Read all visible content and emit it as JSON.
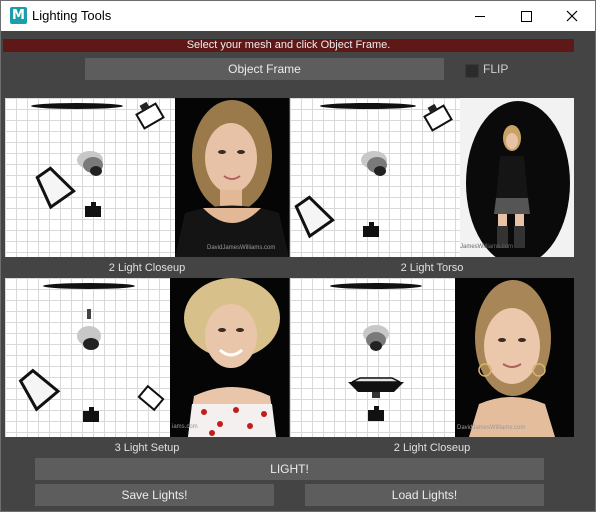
{
  "window": {
    "title": "Lighting Tools",
    "icon": "maya-m-icon",
    "icon_letter": "M"
  },
  "banner": {
    "text": "Select your mesh and click Object Frame.",
    "color": "#5e1818"
  },
  "object_frame": {
    "label": "Object Frame"
  },
  "flip": {
    "label": "FLIP",
    "checked": false
  },
  "presets": [
    {
      "caption": "2 Light Closeup",
      "watermark": "DavidJamesWilliams.com"
    },
    {
      "caption": "2 Light Torso",
      "watermark": "JamesWilliams.com"
    },
    {
      "caption": "3 Light Setup",
      "watermark": "iams.com"
    },
    {
      "caption": "2 Light Closeup",
      "watermark": "DavidJamesWilliams.com"
    }
  ],
  "buttons": {
    "light": "LIGHT!",
    "save": "Save Lights!",
    "load": "Load Lights!"
  },
  "colors": {
    "panel": "#444444",
    "button": "#5d5d5d",
    "text": "#ececec"
  }
}
